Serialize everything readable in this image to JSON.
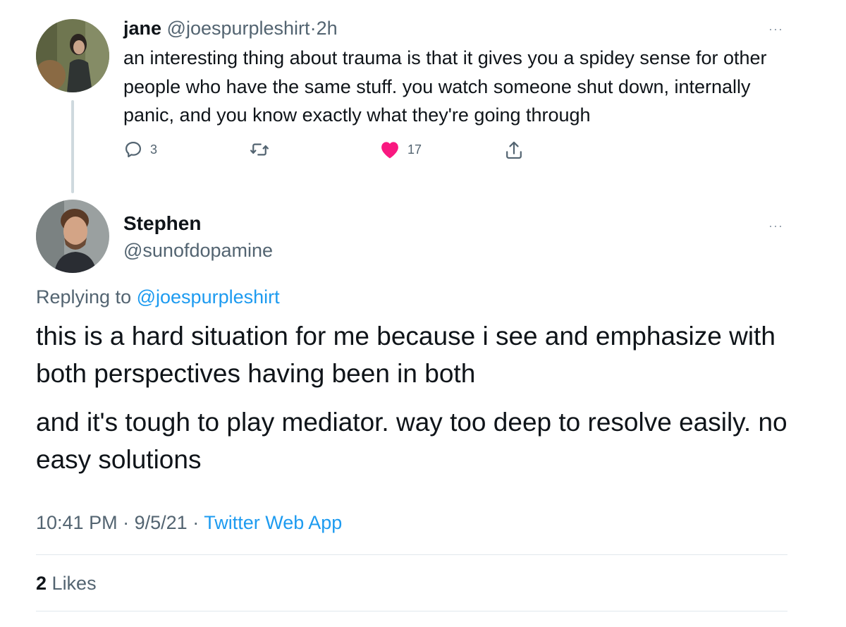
{
  "tweet1": {
    "name": "jane",
    "handle": "@joespurpleshirt",
    "sep": "·",
    "time": "2h",
    "text": "an interesting thing about trauma is that it gives you a spidey sense for other people who have the same stuff. you watch someone shut down, internally panic, and you know exactly what they're going through",
    "reply_count": "3",
    "like_count": "17",
    "more": "···",
    "icons": {
      "reply": "reply-icon",
      "retweet": "retweet-icon",
      "like": "heart-icon",
      "share": "share-icon"
    }
  },
  "tweet2": {
    "name": "Stephen",
    "handle": "@sunofdopamine",
    "more": "···",
    "replying_label": "Replying to",
    "replying_handle": "@joespurpleshirt",
    "paragraph1": "this is a hard situation for me because i see and emphasize with both perspectives having been in both",
    "paragraph2": "and it's tough to play mediator.  way too deep to resolve easily.  no easy solutions",
    "time": "10:41 PM",
    "date": "9/5/21",
    "sep": "·",
    "source": "Twitter Web App",
    "likes_count": "2",
    "likes_label": "Likes"
  },
  "colors": {
    "text": "#0f1419",
    "secondary": "#536471",
    "link": "#1d9bf0",
    "like": "#f91880",
    "divider": "#e1e8ed",
    "thread_line": "#cfd9de"
  }
}
